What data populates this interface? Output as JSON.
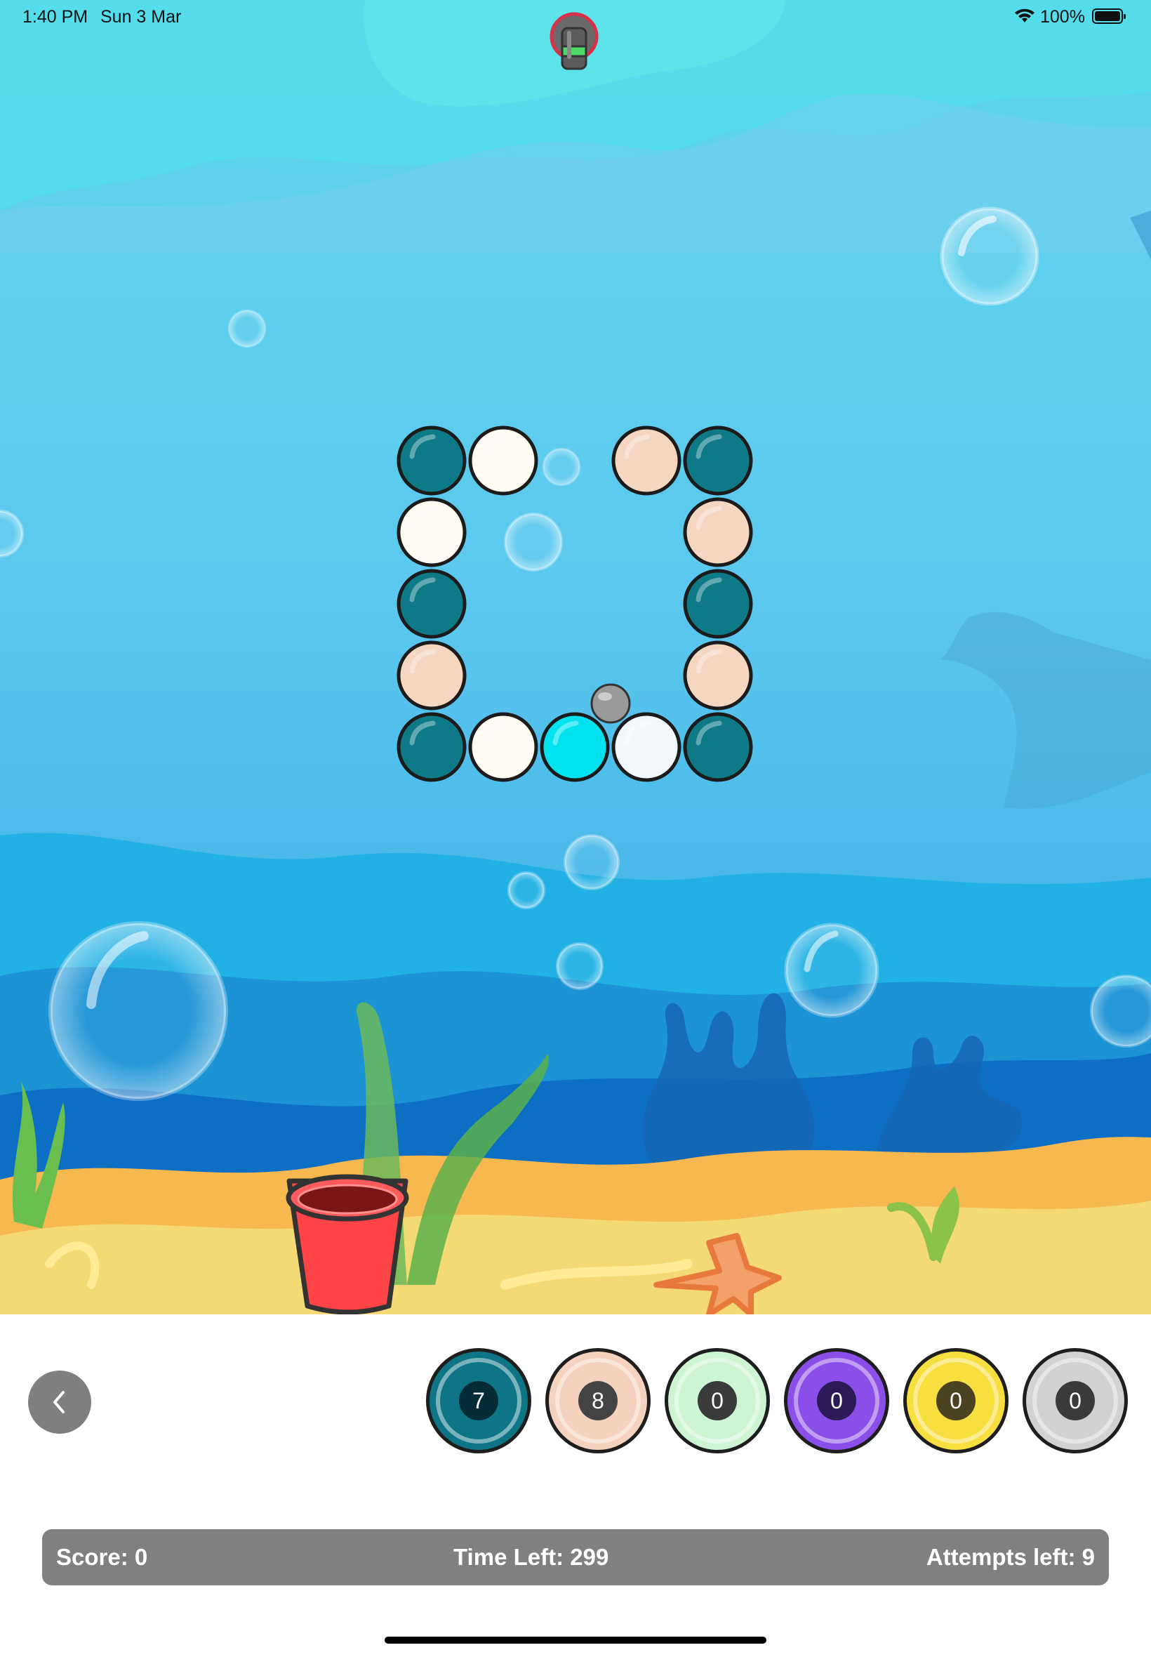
{
  "status_bar": {
    "time": "1:40 PM",
    "date": "Sun 3 Mar",
    "battery": "100%",
    "icons": [
      "wifi-icon",
      "battery-icon"
    ]
  },
  "game": {
    "launcher_icon": "cannon-icon",
    "grid_rows": [
      [
        "teal",
        "cream",
        "empty",
        "peach",
        "teal"
      ],
      [
        "cream",
        "empty",
        "empty",
        "empty",
        "peach"
      ],
      [
        "teal",
        "empty",
        "empty",
        "empty",
        "teal"
      ],
      [
        "peach",
        "empty",
        "empty",
        "empty",
        "peach"
      ],
      [
        "teal",
        "cream",
        "cyan",
        "ice",
        "teal"
      ]
    ],
    "palette": {
      "teal": "#0e7a87",
      "cream": "#fffdf2",
      "peach": "#f5d6c0",
      "cyan": "#00e3ee",
      "ice": "#f0f8fb",
      "gray": "#9a9a9a"
    },
    "projectile_color": "gray",
    "bucket_color": "#ff4447"
  },
  "controls": {
    "back_icon": "chevron-left-icon",
    "ball_buttons": [
      {
        "color": "#0d7585",
        "count": "7",
        "badge": "#032c36"
      },
      {
        "color": "#f4d2bd",
        "count": "8",
        "badge": "#444444"
      },
      {
        "color": "#cdf5d3",
        "count": "0",
        "badge": "#3a3a3a"
      },
      {
        "color": "#8a4fe8",
        "count": "0",
        "badge": "#2b1a55"
      },
      {
        "color": "#f8df40",
        "count": "0",
        "badge": "#4a4220"
      },
      {
        "color": "#d2d2d2",
        "count": "0",
        "badge": "#3a3a3a"
      }
    ]
  },
  "hud": {
    "score": "Score: 0",
    "time_left": "Time Left: 299",
    "attempts": "Attempts left: 9"
  }
}
